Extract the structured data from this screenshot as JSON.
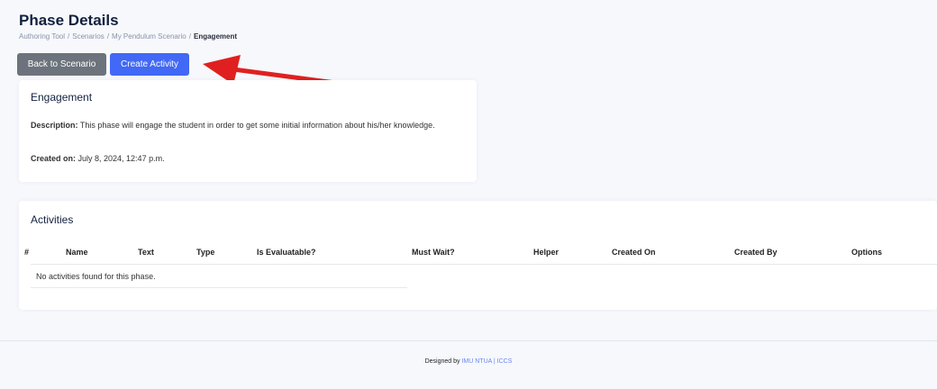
{
  "header": {
    "title": "Phase Details",
    "breadcrumb": [
      "Authoring Tool",
      "Scenarios",
      "My Pendulum Scenario",
      "Engagement"
    ],
    "separator": "/"
  },
  "toolbar": {
    "back_label": "Back to Scenario",
    "create_label": "Create Activity"
  },
  "annotation": {
    "arrow_color": "#e02020"
  },
  "phase": {
    "title": "Engagement",
    "description_label": "Description:",
    "description": " This phase will engage the student in order to get some initial information about his/her knowledge.",
    "created_label": "Created on:",
    "created": " July 8, 2024, 12:47 p.m."
  },
  "activities": {
    "title": "Activities",
    "columns": [
      "#",
      "Name",
      "Text",
      "Type",
      "Is Evaluatable?",
      "Must Wait?",
      "Helper",
      "Created On",
      "Created By",
      "Options"
    ],
    "empty_message": "No activities found for this phase."
  },
  "footer": {
    "designed_by": "Designed by",
    "org1": "IMU NTUA",
    "divider": "|",
    "org2": "ICCS"
  },
  "colors": {
    "primary": "#4268f6",
    "secondary": "#6c737c",
    "title": "#12203f",
    "background": "#f6f8fc"
  }
}
